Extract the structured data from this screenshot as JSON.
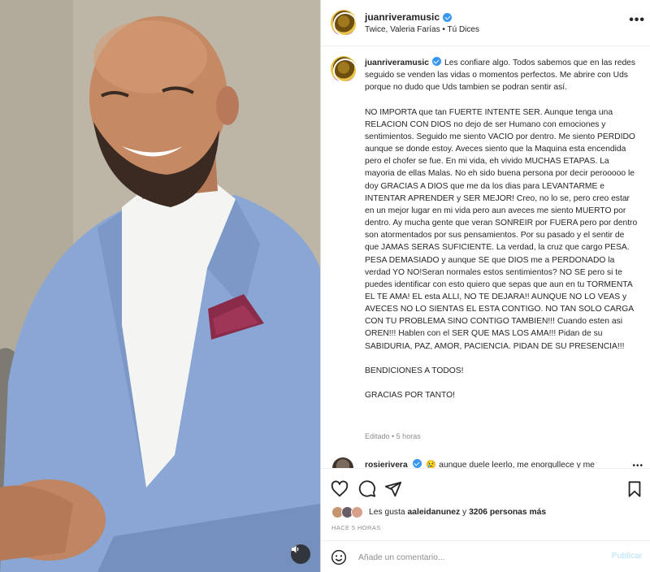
{
  "header": {
    "username": "juanriveramusic",
    "subtitle": "Twice, Valeria Farías • Tú Dices",
    "more": "•••"
  },
  "caption": {
    "username": "juanriveramusic",
    "text": "Les confiare algo. Todos sabemos que en las redes seguido se venden las vidas o momentos perfectos. Me abrire con Uds porque no dudo que Uds tambien se podran sentir así.\n\nNO IMPORTA que tan FUERTE INTENTE SER. Aunque tenga una RELACION CON DIOS no dejo de ser Humano con emociones y sentimientos. Seguido me siento VACIO por dentro. Me siento PERDIDO aunque se donde estoy. Aveces siento que la Maquina esta encendida pero el chofer se fue. En mi vida, eh vivido MUCHAS ETAPAS. La mayoria de ellas Malas. No eh sido buena persona por decir perooooo le doy GRACIAS A DIOS que me da los dias para LEVANTARME e INTENTAR APRENDER y SER MEJOR! Creo, no lo se, pero creo estar en un mejor lugar en mi vida pero aun aveces me siento MUERTO por dentro. Ay mucha gente que veran SONREIR por FUERA pero por dentro son atormentados por sus pensamientos. Por su pasado y el sentir de que JAMAS SERAS SUFICIENTE. La verdad, la cruz que cargo PESA. PESA DEMASIADO y aunque SE que DIOS me a PERDONADO la verdad YO NO!Seran normales estos sentimientos? NO SE pero si te puedes identificar con esto quiero que sepas que aun en tu TORMENTA EL TE AMA! EL esta ALLI, NO TE DEJARA!! AUNQUE NO LO VEAS y AVECES NO LO SIENTAS EL ESTA CONTIGO. NO TAN SOLO CARGA CON TU PROBLEMA SINO CONTIGO TAMBIEN!!! Cuando esten asi OREN!!! Hablen con el SER QUE MAS LOS AMA!!! Pidan de su SABIDURIA, PAZ, AMOR, PACIENCIA. PIDAN DE SU PRESENCIA!!!\n\nBENDICIONES A TODOS!\n\nGRACIAS POR TANTO!",
    "meta": "Editado • 5 horas"
  },
  "comment": {
    "username": "rosierivera",
    "emoji": "😢",
    "text": "aunque duele leerlo, me enorgullece y me",
    "more": "•••"
  },
  "likes": {
    "prefix": "Les gusta ",
    "user": "aaleidanunez",
    "middle": " y ",
    "count": "3206 personas más"
  },
  "time_ago": "HACE 5 HORAS",
  "comment_input": {
    "placeholder": "Añade un comentario...",
    "publish": "Publicar"
  },
  "colors": {
    "verified": "#3897f0",
    "publish_disabled": "#b2dffc",
    "suit": "#8aa6d4"
  },
  "icons": [
    "heart-icon",
    "comment-icon",
    "share-icon",
    "bookmark-icon",
    "emoji-icon",
    "speaker-icon",
    "verified-icon"
  ]
}
